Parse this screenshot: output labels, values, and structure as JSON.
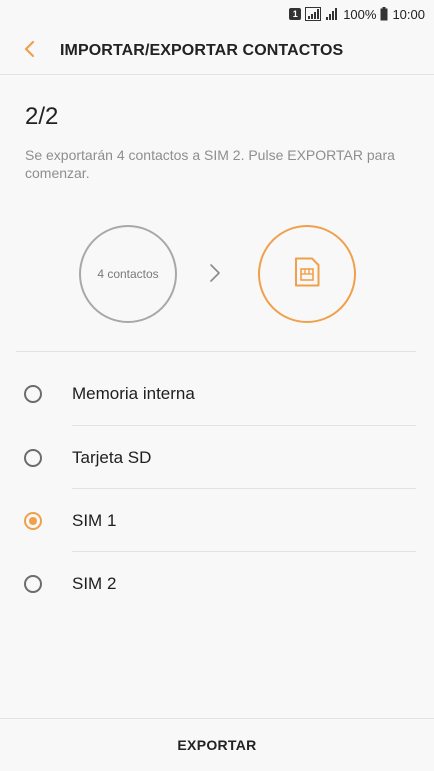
{
  "status_bar": {
    "sim_badge": "1",
    "battery": "100%",
    "time": "10:00"
  },
  "app_bar": {
    "title": "IMPORTAR/EXPORTAR CONTACTOS",
    "back_icon": "chevron-left-icon"
  },
  "step": "2/2",
  "description": "Se exportarán 4 contactos a SIM 2. Pulse EXPORTAR para comenzar.",
  "transfer": {
    "source_label": "4 contactos",
    "arrow_icon": "chevron-right-icon",
    "target_icon": "sim-card-icon"
  },
  "options": [
    {
      "label": "Memoria interna",
      "selected": false
    },
    {
      "label": "Tarjeta SD",
      "selected": false
    },
    {
      "label": "SIM 1",
      "selected": true
    },
    {
      "label": "SIM 2",
      "selected": false
    }
  ],
  "footer": {
    "export_label": "EXPORTAR"
  },
  "colors": {
    "accent": "#f0a04b",
    "background": "#f8f8f8",
    "text": "#1e1e1e",
    "muted": "#8e8e8e"
  }
}
